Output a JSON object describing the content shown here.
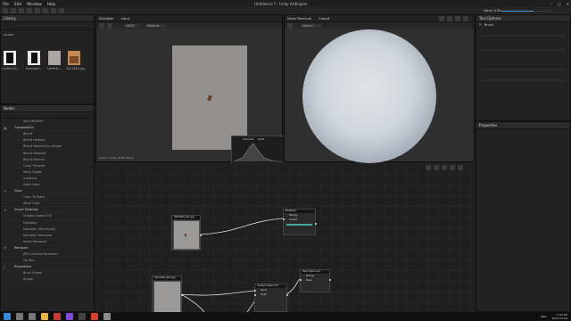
{
  "window": {
    "title": "Untitled.ai ? - Unity ArtEngine",
    "menu": [
      "File",
      "Edit",
      "Window",
      "Help"
    ],
    "controls": {
      "minimize": "–",
      "maximize": "□",
      "close": "✕"
    }
  },
  "toolbar": {
    "value_label": "Value: 0.65"
  },
  "library": {
    "title": "Library",
    "section": "Assets",
    "assets": [
      {
        "name": "LeatherSh..."
      },
      {
        "name": "Exemplar..."
      },
      {
        "name": "Leather..."
      },
      {
        "name": "5SC5624.jpg"
      }
    ]
  },
  "nodes_list": {
    "title": "Nodes",
    "items": [
      {
        "label": "Sort Material",
        "section": false
      },
      {
        "label": "Composition",
        "section": true,
        "icon": "composition-icon",
        "glyph": "▦"
      },
      {
        "label": "Blend",
        "section": false
      },
      {
        "label": "Blend Heights",
        "section": false
      },
      {
        "label": "Blend Material by Height",
        "section": false
      },
      {
        "label": "Blend Material",
        "section": false
      },
      {
        "label": "Blend Normal",
        "section": false
      },
      {
        "label": "Color Transfer",
        "section": false
      },
      {
        "label": "Mask Edges",
        "section": false
      },
      {
        "label": "Gradient",
        "section": false
      },
      {
        "label": "Solid Color",
        "section": false
      },
      {
        "label": "Fluor",
        "section": true,
        "icon": "fluor-icon",
        "glyph": "✎"
      },
      {
        "label": "Color To Mask",
        "section": false
      },
      {
        "label": "Mask Fade",
        "section": false
      },
      {
        "label": "Smart Mutation",
        "section": true,
        "icon": "mutation-icon",
        "glyph": "✦"
      },
      {
        "label": "Content Aware Fill",
        "section": false
      },
      {
        "label": "Mutation",
        "section": false
      },
      {
        "label": "Mutation (Structural)",
        "section": false
      },
      {
        "label": "Mutation Remover",
        "section": false
      },
      {
        "label": "Seam Removal",
        "section": false
      },
      {
        "label": "Remover",
        "section": true,
        "icon": "remover-icon",
        "glyph": "⊘"
      },
      {
        "label": "JPEG Artifact Remover",
        "section": false
      },
      {
        "label": "Up Res",
        "section": false
      },
      {
        "label": "Procedural",
        "section": true,
        "icon": "procedural-icon",
        "glyph": "ƒ"
      },
      {
        "label": "Brick Shape",
        "section": false
      },
      {
        "label": "Shape",
        "section": false
      }
    ]
  },
  "viewport_left": {
    "tabs": [
      "Multiplier",
      "Input"
    ],
    "controls": [
      "100%",
      "Material"
    ],
    "info": "2000 x 3000 | 8 Bit, Bayer",
    "histogram": {
      "label": "Channel",
      "value": "RGB"
    }
  },
  "viewport_right": {
    "tabs": [
      "Seam Removal",
      "Output"
    ],
    "controls": [
      "Sphere"
    ]
  },
  "tool_options": {
    "title": "Tool Options",
    "brush": "Brush"
  },
  "properties": {
    "title": "Properties"
  },
  "graph": {
    "nodes": [
      {
        "id": "a",
        "title": "5SC5624_001.jpg"
      },
      {
        "id": "b",
        "title": "Multiplier",
        "rows": [
          "Bitmap",
          "Output"
        ]
      },
      {
        "id": "c",
        "title": "Seamless_001.jpg"
      },
      {
        "id": "d",
        "title": "Content Aware Fill",
        "rows": [
          "Input",
          "Mask"
        ]
      },
      {
        "id": "e",
        "title": "Seam Removal",
        "rows": [
          "Bitmap",
          "Mask"
        ]
      }
    ]
  },
  "taskbar": {
    "time": "4:42 PM",
    "date": "2021-03-28",
    "lang": "ENG",
    "apps": [
      {
        "name": "windows-icon",
        "color": "#3a88d8"
      },
      {
        "name": "search-icon",
        "color": "#777777"
      },
      {
        "name": "taskview-icon",
        "color": "#777777"
      },
      {
        "name": "folder-icon",
        "color": "#e7b640"
      },
      {
        "name": "app-icon-1",
        "color": "#c43b3b"
      },
      {
        "name": "visual-studio-icon",
        "color": "#7b4ad6"
      },
      {
        "name": "app-icon-2",
        "color": "#444444"
      },
      {
        "name": "app-icon-3",
        "color": "#d8412c"
      },
      {
        "name": "app-icon-4",
        "color": "#8a8a8a"
      }
    ]
  }
}
